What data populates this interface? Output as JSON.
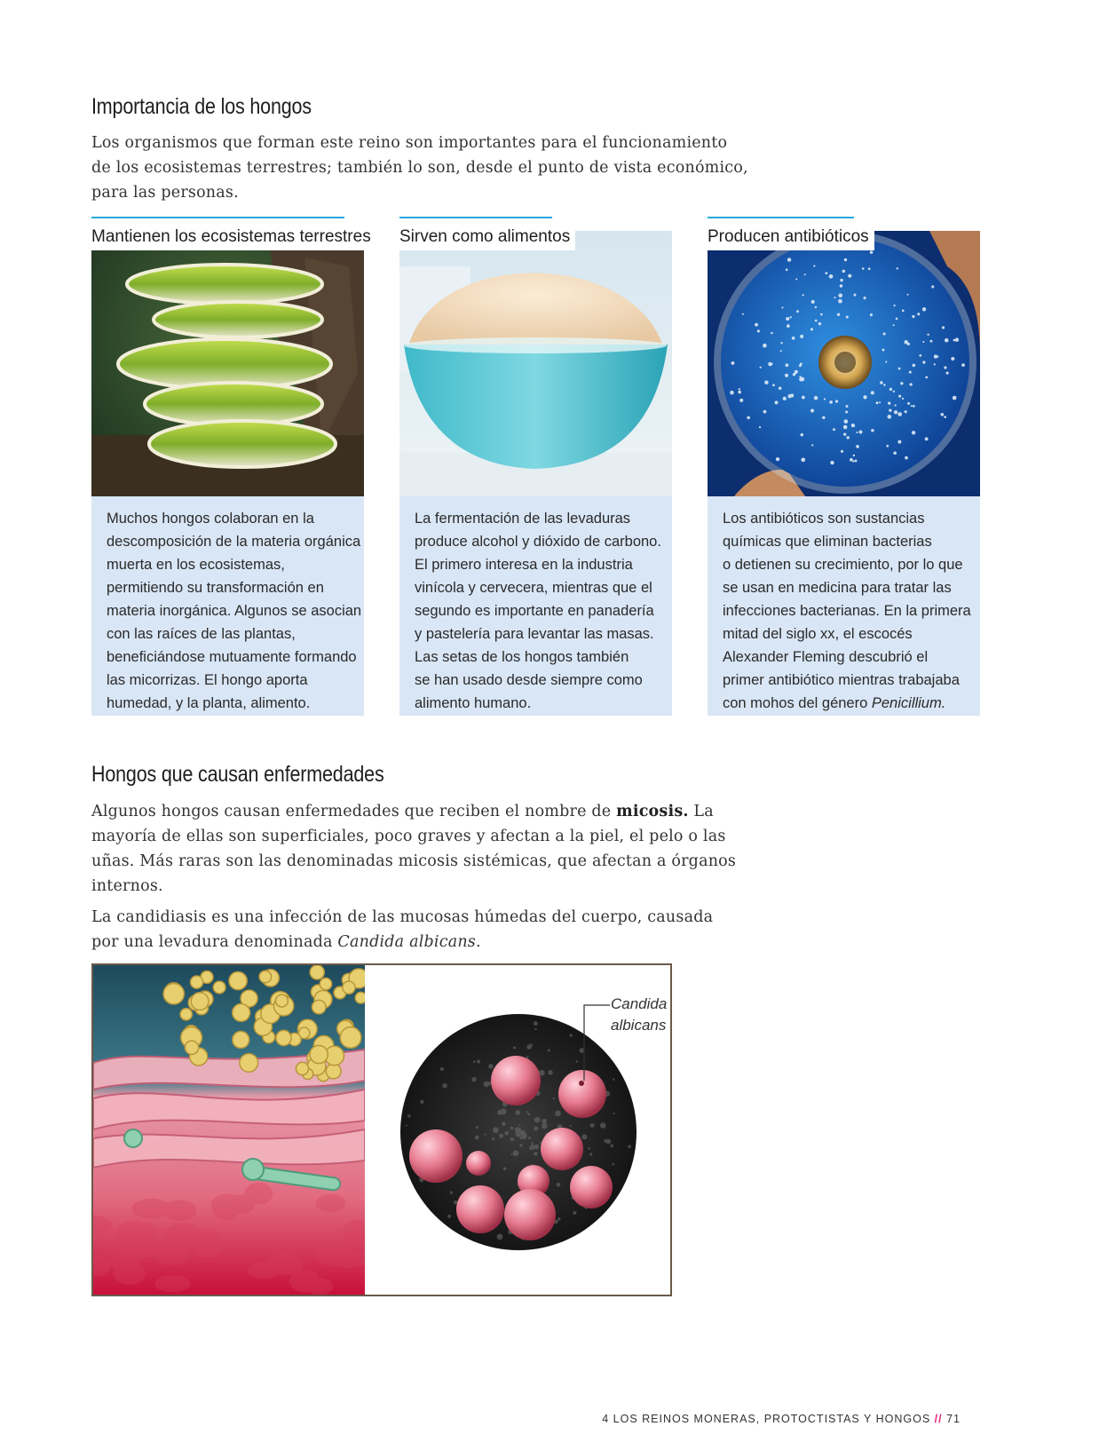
{
  "section1": {
    "title": "Importancia de los hongos",
    "intro_lines": [
      "Los organismos que forman este reino son importantes para el funcionamiento",
      "de los ecosistemas terrestres; también lo son, desde el punto de vista económico,",
      "para las personas."
    ]
  },
  "cards": [
    {
      "heading": "Mantienen los ecosistemas terrestres",
      "lines": [
        "Muchos hongos colaboran en la",
        "descomposición de la materia orgánica",
        "muerta en los ecosistemas,",
        "permitiendo su transformación en",
        "materia inorgánica. Algunos se asocian",
        "con las raíces de las plantas,",
        "beneficiándose mutuamente formando",
        "las micorrizas. El hongo aporta",
        "humedad, y la planta, alimento."
      ]
    },
    {
      "heading": "Sirven como alimentos",
      "lines": [
        "La fermentación de las levaduras",
        "produce alcohol y dióxido de carbono.",
        "El primero interesa en la industria",
        "vinícola y cervecera, mientras que el",
        "segundo es importante en panadería",
        "y pastelería para levantar las masas.",
        "Las setas de los hongos también",
        "se han usado desde siempre como",
        "alimento humano."
      ]
    },
    {
      "heading": "Producen antibióticos",
      "lines": [
        "Los antibióticos son sustancias",
        "químicas que eliminan bacterias",
        "o detienen su crecimiento, por lo que",
        "se usan en medicina para tratar las",
        "infecciones bacterianas. En la primera",
        "mitad del siglo xx, el escocés",
        "Alexander Fleming descubrió el",
        "primer antibiótico mientras trabajaba",
        "con mohos del género Penicillium."
      ]
    }
  ],
  "section2": {
    "title": "Hongos que causan enfermedades",
    "para1_lines": [
      "Algunos hongos causan enfermedades que reciben el nombre de micosis. La",
      "mayoría de ellas son superficiales, poco graves y afectan a la piel, el pelo o las",
      "uñas. Más raras son las denominadas micosis sistémicas, que afectan a órganos",
      "internos."
    ],
    "para2_lines": [
      "La candidiasis es una infección de las mucosas húmedas del cuerpo, causada",
      "por una levadura denominada Candida albicans."
    ],
    "micrograph_label_line1": "Candida",
    "micrograph_label_line2": "albicans"
  },
  "footer": {
    "chapter": "4 LOS REINOS MONERAS, PROTOCTISTAS Y HONGOS",
    "separator": "//",
    "page_number": "71"
  },
  "colors": {
    "accent_blue": "#29a8e0",
    "card_bg": "#d9e6f5",
    "footer_pink": "#e4247b"
  }
}
